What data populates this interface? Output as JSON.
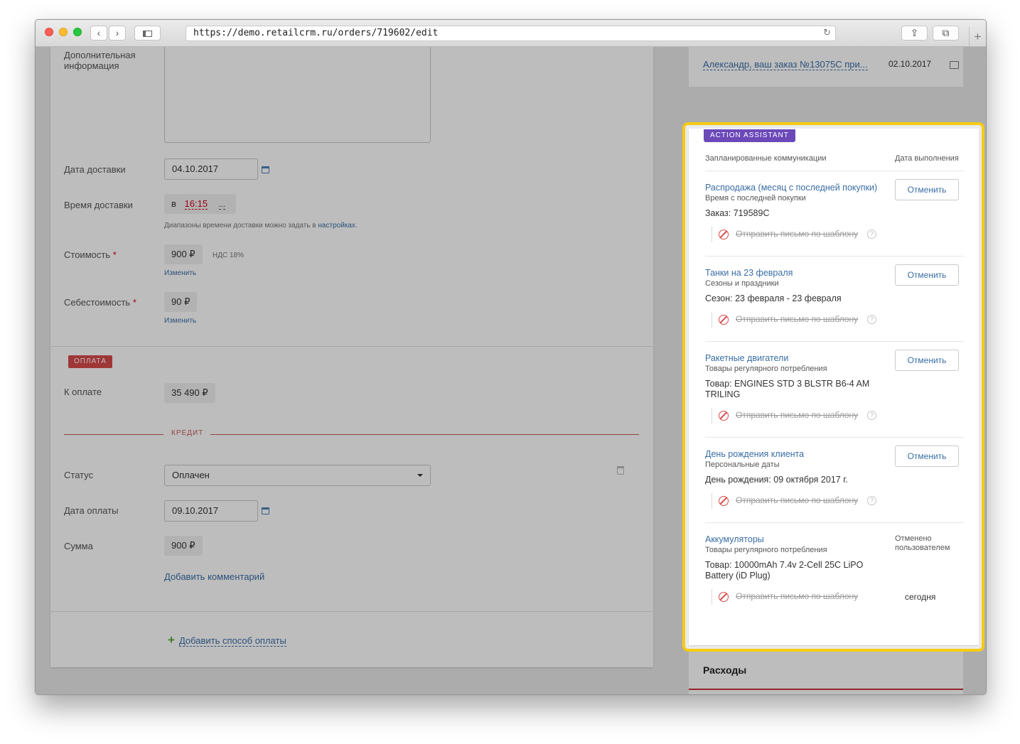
{
  "browser": {
    "url": "https://demo.retailcrm.ru/orders/719602/edit",
    "back_glyph": "‹",
    "forward_glyph": "›",
    "reload_glyph": "↻",
    "share_glyph": "⇪",
    "tabs_glyph": "⧉",
    "newtab_glyph": "+"
  },
  "delivery": {
    "extra_info_label": "Дополнительная информация",
    "date_label": "Дата доставки",
    "date_value": "04.10.2017",
    "time_label": "Время доставки",
    "time_prefix": "в",
    "time_value": "16:15",
    "time_suffix": "...",
    "ranges_hint": "Диапазоны времени доставки можно задать в",
    "ranges_link": "настройках",
    "ranges_dot": ".",
    "cost_label": "Стоимость",
    "cost_value": "900 ₽",
    "cost_vat": "НДС 18%",
    "cost_change": "Изменить",
    "self_cost_label": "Себестоимость",
    "self_cost_value": "90 ₽",
    "self_cost_change": "Изменить",
    "required_mark": "*"
  },
  "payment": {
    "section_badge": "ОПЛАТА",
    "to_pay_label": "К оплате",
    "to_pay_value": "35 490 ₽",
    "credit_label": "КРЕДИТ",
    "status_label": "Статус",
    "status_value": "Оплачен",
    "pay_date_label": "Дата оплаты",
    "pay_date_value": "09.10.2017",
    "sum_label": "Сумма",
    "sum_value": "900 ₽",
    "add_comment": "Добавить комментарий",
    "add_method_plus": "+",
    "add_method": "Добавить способ оплаты"
  },
  "right_top": {
    "letter_link": "Александр, ваш заказ №13075С при...",
    "letter_date": "02.10.2017"
  },
  "action_assistant": {
    "badge": "ACTION ASSISTANT",
    "col_planned": "Запланированные коммуникации",
    "col_date": "Дата выполнения",
    "cancel_label": "Отменить",
    "action_label": "Отправить письмо по шаблону",
    "help_glyph": "?",
    "items": [
      {
        "title": "Распродажа (месяц с последней покупки)",
        "subtitle": "Время с последней покупки",
        "value": "Заказ: 719589С"
      },
      {
        "title": "Танки на 23 февраля",
        "subtitle": "Сезоны и праздники",
        "value": "Сезон: 23 февраля - 23 февраля"
      },
      {
        "title": "Ракетные двигатели",
        "subtitle": "Товары регулярного потребления",
        "value": "Товар: ENGINES STD 3 BLSTR B6-4 AM TRILING"
      },
      {
        "title": "День рождения клиента",
        "subtitle": "Персональные даты",
        "value": "День рождения: 09 октября 2017 г."
      },
      {
        "title": "Аккумуляторы",
        "subtitle": "Товары регулярного потребления",
        "value": "Товар: 10000mAh 7.4v 2-Cell 25C LiPO Battery (iD Plug)",
        "status": "Отменено пользователем",
        "when": "сегодня"
      }
    ]
  },
  "expenses": {
    "title": "Расходы"
  },
  "colors": {
    "highlight": "#f7cb14",
    "badge_purple": "#6b49b9",
    "badge_red": "#d74a4a",
    "link": "#3a6ea5",
    "ban": "#d84a4a"
  }
}
